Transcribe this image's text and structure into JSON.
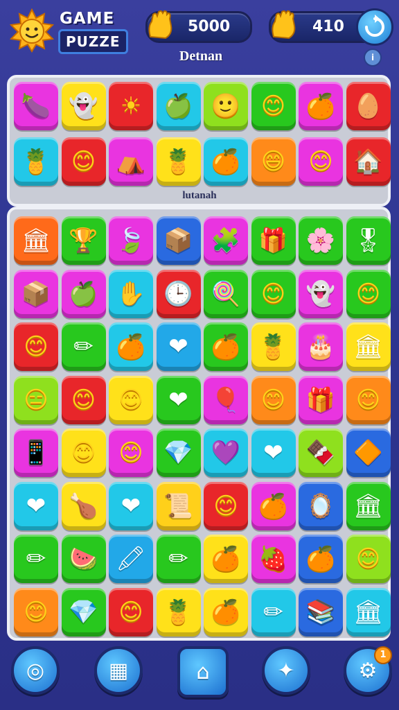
{
  "header": {
    "title_line1": "GAME",
    "title_line2": "PUZZE",
    "counter1_value": "5000",
    "counter2_value": "410",
    "subtitle": "Detnan"
  },
  "top_panel": {
    "label": "lutanah",
    "rows": [
      [
        {
          "color": "#e934e0",
          "glyph": "🍆",
          "name": "eggplant"
        },
        {
          "color": "#ffe11a",
          "glyph": "👻",
          "name": "ghost-face"
        },
        {
          "color": "#e8262a",
          "glyph": "☀",
          "name": "sun-face"
        },
        {
          "color": "#22c8e8",
          "glyph": "🍏",
          "name": "green-apple"
        },
        {
          "color": "#8fe01e",
          "glyph": "🙂",
          "name": "smiley-face"
        },
        {
          "color": "#28c81e",
          "glyph": "😊",
          "name": "smiley-face"
        },
        {
          "color": "#e934e0",
          "glyph": "🍊",
          "name": "orange-face"
        },
        {
          "color": "#e8262a",
          "glyph": "🥚",
          "name": "egg"
        }
      ],
      [
        {
          "color": "#22c8e8",
          "glyph": "🍍",
          "name": "pineapple-face"
        },
        {
          "color": "#e8262a",
          "glyph": "😊",
          "name": "smiley-face"
        },
        {
          "color": "#e934e0",
          "glyph": "⛺",
          "name": "house"
        },
        {
          "color": "#ffe11a",
          "glyph": "🍍",
          "name": "pineapple-face"
        },
        {
          "color": "#22c8e8",
          "glyph": "🍊",
          "name": "orange-face"
        },
        {
          "color": "#ff8a1a",
          "glyph": "😄",
          "name": "crowned-face"
        },
        {
          "color": "#e934e0",
          "glyph": "😊",
          "name": "smiley-face"
        },
        {
          "color": "#e8262a",
          "glyph": "🏠",
          "name": "building"
        }
      ]
    ]
  },
  "bottom_panel": {
    "rows": [
      [
        {
          "color": "#ff6a1a",
          "glyph": "🏛",
          "name": "temple"
        },
        {
          "color": "#28c81e",
          "glyph": "🏆",
          "name": "trophy"
        },
        {
          "color": "#e934e0",
          "glyph": "🍃",
          "name": "leaf"
        },
        {
          "color": "#2a6ae0",
          "glyph": "📦",
          "name": "box"
        },
        {
          "color": "#e934e0",
          "glyph": "🧩",
          "name": "puzzle-piece"
        },
        {
          "color": "#28c81e",
          "glyph": "🎁",
          "name": "gift"
        },
        {
          "color": "#28c81e",
          "glyph": "🌸",
          "name": "flower"
        },
        {
          "color": "#28c81e",
          "glyph": "🎖",
          "name": "medal"
        }
      ],
      [
        {
          "color": "#e934e0",
          "glyph": "📦",
          "name": "box"
        },
        {
          "color": "#e934e0",
          "glyph": "🍏",
          "name": "green-apple"
        },
        {
          "color": "#22c8e8",
          "glyph": "✋",
          "name": "hand"
        },
        {
          "color": "#e8262a",
          "glyph": "🕒",
          "name": "clock"
        },
        {
          "color": "#28c81e",
          "glyph": "🍭",
          "name": "lollipop"
        },
        {
          "color": "#28c81e",
          "glyph": "😊",
          "name": "smiley-face"
        },
        {
          "color": "#e934e0",
          "glyph": "👻",
          "name": "ghost"
        },
        {
          "color": "#28c81e",
          "glyph": "😊",
          "name": "smiley-face"
        }
      ],
      [
        {
          "color": "#e8262a",
          "glyph": "😊",
          "name": "pink-face"
        },
        {
          "color": "#28c81e",
          "glyph": "✏",
          "name": "pencil"
        },
        {
          "color": "#22c8e8",
          "glyph": "🍊",
          "name": "orange-face"
        },
        {
          "color": "#22a8e8",
          "glyph": "❤",
          "name": "heart"
        },
        {
          "color": "#28c81e",
          "glyph": "🍊",
          "name": "orange-face"
        },
        {
          "color": "#ffe11a",
          "glyph": "🍍",
          "name": "pineapple-face"
        },
        {
          "color": "#e934e0",
          "glyph": "🎂",
          "name": "cake"
        },
        {
          "color": "#ffe11a",
          "glyph": "🏛",
          "name": "temple"
        }
      ],
      [
        {
          "color": "#8fe01e",
          "glyph": "😑",
          "name": "sleepy-face"
        },
        {
          "color": "#e8262a",
          "glyph": "😊",
          "name": "crowned-face"
        },
        {
          "color": "#ffe11a",
          "glyph": "😊",
          "name": "teal-face"
        },
        {
          "color": "#28c81e",
          "glyph": "❤",
          "name": "heart"
        },
        {
          "color": "#e934e0",
          "glyph": "🎈",
          "name": "balloon"
        },
        {
          "color": "#ff8a1a",
          "glyph": "😊",
          "name": "pink-face"
        },
        {
          "color": "#e934e0",
          "glyph": "🎁",
          "name": "gift"
        },
        {
          "color": "#ff8a1a",
          "glyph": "😊",
          "name": "red-face"
        }
      ],
      [
        {
          "color": "#e934e0",
          "glyph": "📱",
          "name": "phone"
        },
        {
          "color": "#ffe11a",
          "glyph": "😊",
          "name": "green-face"
        },
        {
          "color": "#e934e0",
          "glyph": "😊",
          "name": "blue-face"
        },
        {
          "color": "#28c81e",
          "glyph": "💎",
          "name": "gem"
        },
        {
          "color": "#22c8e8",
          "glyph": "💜",
          "name": "sparkle-heart"
        },
        {
          "color": "#22c8e8",
          "glyph": "❤",
          "name": "heart"
        },
        {
          "color": "#8fe01e",
          "glyph": "🍫",
          "name": "chocolate"
        },
        {
          "color": "#2a6ae0",
          "glyph": "🔶",
          "name": "badge"
        }
      ],
      [
        {
          "color": "#22c8e8",
          "glyph": "❤",
          "name": "heart"
        },
        {
          "color": "#ffe11a",
          "glyph": "🍗",
          "name": "drumstick"
        },
        {
          "color": "#22c8e8",
          "glyph": "❤",
          "name": "heart"
        },
        {
          "color": "#ffd01a",
          "glyph": "📜",
          "name": "scroll"
        },
        {
          "color": "#e8262a",
          "glyph": "😊",
          "name": "white-face"
        },
        {
          "color": "#e934e0",
          "glyph": "🍊",
          "name": "orange-face"
        },
        {
          "color": "#2a6ae0",
          "glyph": "🪞",
          "name": "mirror"
        },
        {
          "color": "#28c81e",
          "glyph": "🏛",
          "name": "temple"
        }
      ],
      [
        {
          "color": "#28c81e",
          "glyph": "✏",
          "name": "pencil"
        },
        {
          "color": "#28c81e",
          "glyph": "🍉",
          "name": "watermelon"
        },
        {
          "color": "#22a8e8",
          "glyph": "🖍",
          "name": "crayon"
        },
        {
          "color": "#28c81e",
          "glyph": "✏",
          "name": "pencil"
        },
        {
          "color": "#ffe11a",
          "glyph": "🍊",
          "name": "orange-face"
        },
        {
          "color": "#e934e0",
          "glyph": "🍓",
          "name": "strawberry-face"
        },
        {
          "color": "#2a6ae0",
          "glyph": "🍊",
          "name": "orange-face"
        },
        {
          "color": "#8fe01e",
          "glyph": "😊",
          "name": "crowned-face"
        }
      ],
      [
        {
          "color": "#ff8a1a",
          "glyph": "😊",
          "name": "pink-face"
        },
        {
          "color": "#28c81e",
          "glyph": "💎",
          "name": "gem"
        },
        {
          "color": "#e8262a",
          "glyph": "😊",
          "name": "crowned-face"
        },
        {
          "color": "#ffe11a",
          "glyph": "🍍",
          "name": "pineapple-face"
        },
        {
          "color": "#ffe11a",
          "glyph": "🍊",
          "name": "orange"
        },
        {
          "color": "#22c8e8",
          "glyph": "✏",
          "name": "pencil"
        },
        {
          "color": "#2a6ae0",
          "glyph": "📚",
          "name": "books"
        },
        {
          "color": "#22c8e8",
          "glyph": "🏛",
          "name": "temple"
        }
      ]
    ]
  },
  "footer": {
    "buttons": [
      {
        "name": "ring-button",
        "glyph": "◎"
      },
      {
        "name": "map-button",
        "glyph": "▦"
      },
      {
        "name": "home-button",
        "glyph": "⌂"
      },
      {
        "name": "shuffle-button",
        "glyph": "✦"
      },
      {
        "name": "settings-button",
        "glyph": "⚙",
        "badge": "1"
      }
    ]
  }
}
